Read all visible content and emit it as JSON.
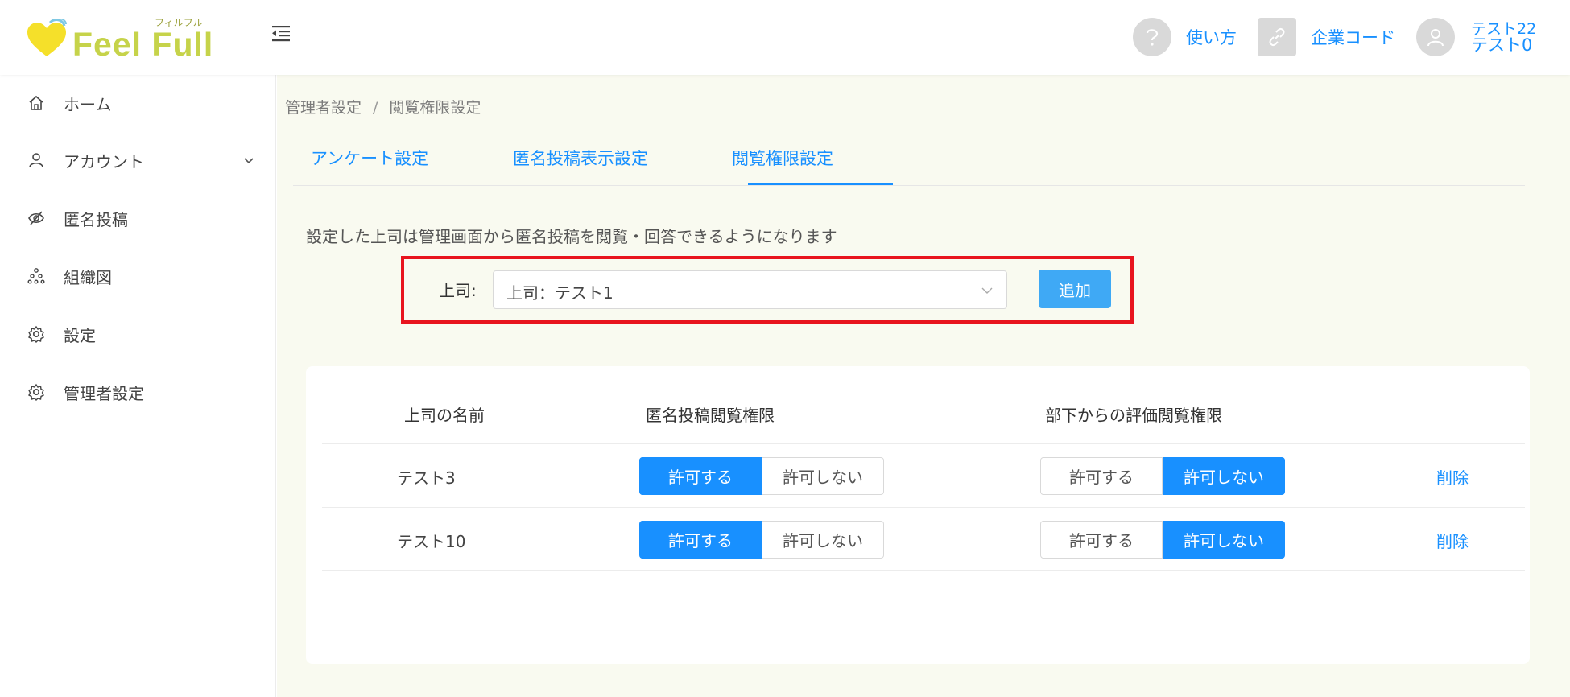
{
  "header": {
    "logo_text": "Feel Full",
    "logo_kana": "フィルフル",
    "help_label": "使い方",
    "company_code_label": "企業コード",
    "user_line1": "テスト22",
    "user_line2": "テスト0",
    "accent_color": "#1890ff",
    "logo_color": "#c6d34a",
    "heart_color": "#f5e02a"
  },
  "sidebar": {
    "items": [
      {
        "label": "ホーム",
        "icon": "home-icon"
      },
      {
        "label": "アカウント",
        "icon": "user-icon"
      },
      {
        "label": "匿名投稿",
        "icon": "eye-off-icon"
      },
      {
        "label": "組織図",
        "icon": "org-chart-icon"
      },
      {
        "label": "設定",
        "icon": "gear-icon"
      },
      {
        "label": "管理者設定",
        "icon": "gear-icon"
      }
    ]
  },
  "breadcrumb": {
    "items": [
      "管理者設定",
      "閲覧権限設定"
    ],
    "separator": "/"
  },
  "tabs": [
    {
      "label": "アンケート設定"
    },
    {
      "label": "匿名投稿表示設定"
    },
    {
      "label": "閲覧権限設定",
      "active": true
    }
  ],
  "description": "設定した上司は管理画面から匿名投稿を閲覧・回答できるようになります",
  "form": {
    "label": "上司:",
    "selected_value": "上司：テスト1",
    "add_button": "追加"
  },
  "table": {
    "headers": [
      "上司の名前",
      "匿名投稿閲覧権限",
      "部下からの評価閲覧権限"
    ],
    "allow_label": "許可する",
    "deny_label": "許可しない",
    "delete_label": "削除",
    "rows": [
      {
        "name": "テスト3",
        "anonymous_view": "allow",
        "evaluation_view": "deny"
      },
      {
        "name": "テスト10",
        "anonymous_view": "allow",
        "evaluation_view": "deny"
      }
    ]
  }
}
